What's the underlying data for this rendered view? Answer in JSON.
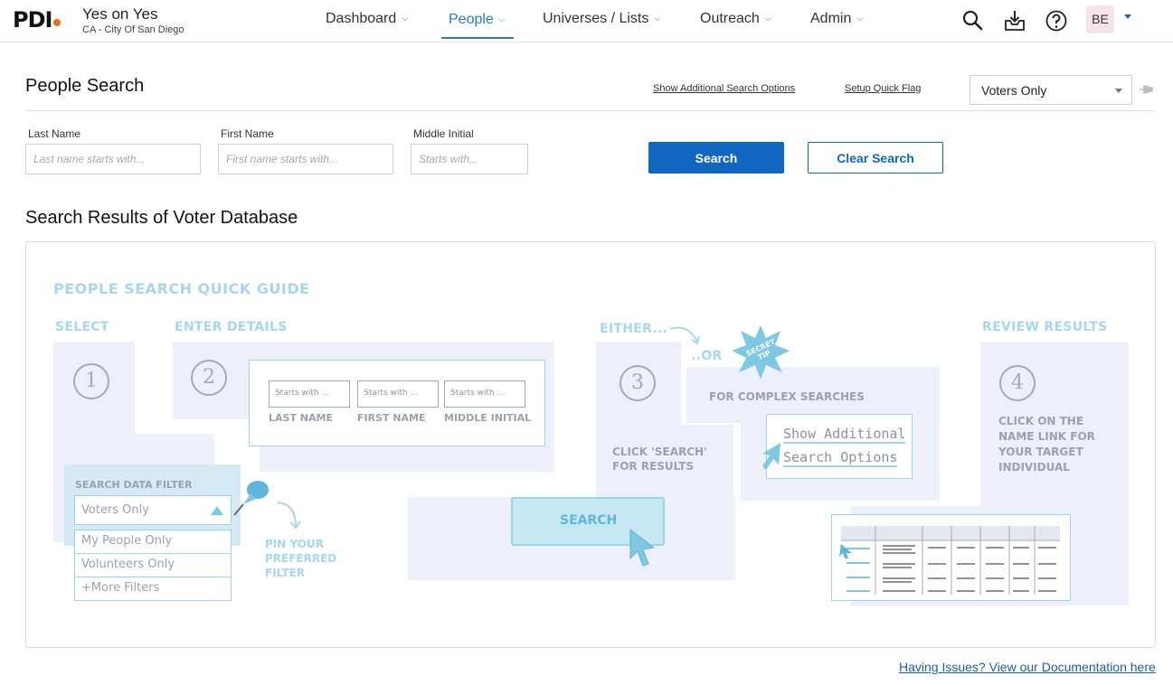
{
  "header": {
    "logo": "PDI",
    "campaign_name": "Yes on Yes",
    "campaign_location": "CA - City Of San Diego",
    "nav": [
      {
        "label": "Dashboard"
      },
      {
        "label": "People"
      },
      {
        "label": "Universes / Lists"
      },
      {
        "label": "Outreach"
      },
      {
        "label": "Admin"
      }
    ],
    "user_initials": "BE",
    "icons": [
      "search-icon",
      "download-tray-icon",
      "help-icon",
      "caret-down-icon"
    ]
  },
  "search": {
    "title": "People Search",
    "show_additional_label": "Show Additional Search Options",
    "setup_quick_flag_label": "Setup Quick Flag",
    "filter_selected": "Voters Only",
    "fields": [
      {
        "label": "Last Name",
        "placeholder": "Last name starts with..."
      },
      {
        "label": "First Name",
        "placeholder": "First name starts with..."
      },
      {
        "label": "Middle Initial",
        "placeholder": "Starts with..."
      }
    ],
    "search_button": "Search",
    "clear_button": "Clear Search"
  },
  "results": {
    "title": "Search Results of Voter Database"
  },
  "guide": {
    "title": "People Search Quick Guide",
    "step_select": "Select",
    "step_enter": "Enter Details",
    "step_either": "Either...",
    "step_or": "..Or",
    "step_review": "Review Results",
    "secret_tip": "Secret Tip",
    "nums": [
      "1",
      "2",
      "3",
      "4"
    ],
    "mini_placeholder": "Starts with ...",
    "mini_labels": [
      "Last Name",
      "First Name",
      "Middle Initial"
    ],
    "filter_heading": "Search Data Filter",
    "filter_options": [
      "Voters Only",
      "My People Only",
      "Volunteers Only",
      "+More Filters"
    ],
    "pin_text": "Pin your preferred filter",
    "click_search": "Click 'Search' for results",
    "search_label": "Search",
    "complex": "For complex searches",
    "show_additional_1": "Show Additional",
    "show_additional_2": "Search Options",
    "review_text": "Click on the name link for your target individual"
  },
  "footer": {
    "doc_link": "Having Issues? View our Documentation here"
  },
  "colors": {
    "primary": "#1066c0",
    "nav_active": "#2a7ac0",
    "brand_orange": "#f26a1b",
    "guide_accent": "#a7d7ea"
  }
}
